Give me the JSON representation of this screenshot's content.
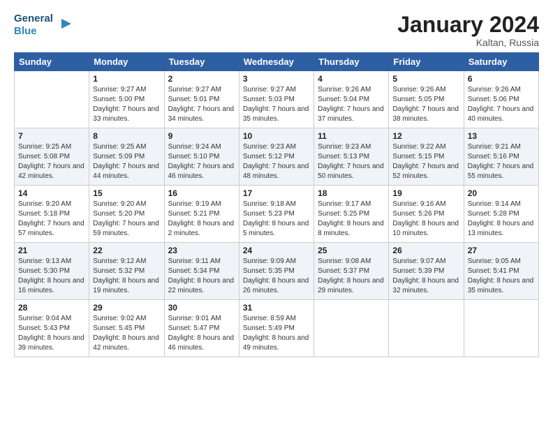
{
  "logo": {
    "line1": "General",
    "line2": "Blue"
  },
  "title": "January 2024",
  "location": "Kaltan, Russia",
  "days_header": [
    "Sunday",
    "Monday",
    "Tuesday",
    "Wednesday",
    "Thursday",
    "Friday",
    "Saturday"
  ],
  "weeks": [
    [
      {
        "num": "",
        "sunrise": "",
        "sunset": "",
        "daylight": ""
      },
      {
        "num": "1",
        "sunrise": "Sunrise: 9:27 AM",
        "sunset": "Sunset: 5:00 PM",
        "daylight": "Daylight: 7 hours and 33 minutes."
      },
      {
        "num": "2",
        "sunrise": "Sunrise: 9:27 AM",
        "sunset": "Sunset: 5:01 PM",
        "daylight": "Daylight: 7 hours and 34 minutes."
      },
      {
        "num": "3",
        "sunrise": "Sunrise: 9:27 AM",
        "sunset": "Sunset: 5:03 PM",
        "daylight": "Daylight: 7 hours and 35 minutes."
      },
      {
        "num": "4",
        "sunrise": "Sunrise: 9:26 AM",
        "sunset": "Sunset: 5:04 PM",
        "daylight": "Daylight: 7 hours and 37 minutes."
      },
      {
        "num": "5",
        "sunrise": "Sunrise: 9:26 AM",
        "sunset": "Sunset: 5:05 PM",
        "daylight": "Daylight: 7 hours and 38 minutes."
      },
      {
        "num": "6",
        "sunrise": "Sunrise: 9:26 AM",
        "sunset": "Sunset: 5:06 PM",
        "daylight": "Daylight: 7 hours and 40 minutes."
      }
    ],
    [
      {
        "num": "7",
        "sunrise": "Sunrise: 9:25 AM",
        "sunset": "Sunset: 5:08 PM",
        "daylight": "Daylight: 7 hours and 42 minutes."
      },
      {
        "num": "8",
        "sunrise": "Sunrise: 9:25 AM",
        "sunset": "Sunset: 5:09 PM",
        "daylight": "Daylight: 7 hours and 44 minutes."
      },
      {
        "num": "9",
        "sunrise": "Sunrise: 9:24 AM",
        "sunset": "Sunset: 5:10 PM",
        "daylight": "Daylight: 7 hours and 46 minutes."
      },
      {
        "num": "10",
        "sunrise": "Sunrise: 9:23 AM",
        "sunset": "Sunset: 5:12 PM",
        "daylight": "Daylight: 7 hours and 48 minutes."
      },
      {
        "num": "11",
        "sunrise": "Sunrise: 9:23 AM",
        "sunset": "Sunset: 5:13 PM",
        "daylight": "Daylight: 7 hours and 50 minutes."
      },
      {
        "num": "12",
        "sunrise": "Sunrise: 9:22 AM",
        "sunset": "Sunset: 5:15 PM",
        "daylight": "Daylight: 7 hours and 52 minutes."
      },
      {
        "num": "13",
        "sunrise": "Sunrise: 9:21 AM",
        "sunset": "Sunset: 5:16 PM",
        "daylight": "Daylight: 7 hours and 55 minutes."
      }
    ],
    [
      {
        "num": "14",
        "sunrise": "Sunrise: 9:20 AM",
        "sunset": "Sunset: 5:18 PM",
        "daylight": "Daylight: 7 hours and 57 minutes."
      },
      {
        "num": "15",
        "sunrise": "Sunrise: 9:20 AM",
        "sunset": "Sunset: 5:20 PM",
        "daylight": "Daylight: 7 hours and 59 minutes."
      },
      {
        "num": "16",
        "sunrise": "Sunrise: 9:19 AM",
        "sunset": "Sunset: 5:21 PM",
        "daylight": "Daylight: 8 hours and 2 minutes."
      },
      {
        "num": "17",
        "sunrise": "Sunrise: 9:18 AM",
        "sunset": "Sunset: 5:23 PM",
        "daylight": "Daylight: 8 hours and 5 minutes."
      },
      {
        "num": "18",
        "sunrise": "Sunrise: 9:17 AM",
        "sunset": "Sunset: 5:25 PM",
        "daylight": "Daylight: 8 hours and 8 minutes."
      },
      {
        "num": "19",
        "sunrise": "Sunrise: 9:16 AM",
        "sunset": "Sunset: 5:26 PM",
        "daylight": "Daylight: 8 hours and 10 minutes."
      },
      {
        "num": "20",
        "sunrise": "Sunrise: 9:14 AM",
        "sunset": "Sunset: 5:28 PM",
        "daylight": "Daylight: 8 hours and 13 minutes."
      }
    ],
    [
      {
        "num": "21",
        "sunrise": "Sunrise: 9:13 AM",
        "sunset": "Sunset: 5:30 PM",
        "daylight": "Daylight: 8 hours and 16 minutes."
      },
      {
        "num": "22",
        "sunrise": "Sunrise: 9:12 AM",
        "sunset": "Sunset: 5:32 PM",
        "daylight": "Daylight: 8 hours and 19 minutes."
      },
      {
        "num": "23",
        "sunrise": "Sunrise: 9:11 AM",
        "sunset": "Sunset: 5:34 PM",
        "daylight": "Daylight: 8 hours and 22 minutes."
      },
      {
        "num": "24",
        "sunrise": "Sunrise: 9:09 AM",
        "sunset": "Sunset: 5:35 PM",
        "daylight": "Daylight: 8 hours and 26 minutes."
      },
      {
        "num": "25",
        "sunrise": "Sunrise: 9:08 AM",
        "sunset": "Sunset: 5:37 PM",
        "daylight": "Daylight: 8 hours and 29 minutes."
      },
      {
        "num": "26",
        "sunrise": "Sunrise: 9:07 AM",
        "sunset": "Sunset: 5:39 PM",
        "daylight": "Daylight: 8 hours and 32 minutes."
      },
      {
        "num": "27",
        "sunrise": "Sunrise: 9:05 AM",
        "sunset": "Sunset: 5:41 PM",
        "daylight": "Daylight: 8 hours and 35 minutes."
      }
    ],
    [
      {
        "num": "28",
        "sunrise": "Sunrise: 9:04 AM",
        "sunset": "Sunset: 5:43 PM",
        "daylight": "Daylight: 8 hours and 39 minutes."
      },
      {
        "num": "29",
        "sunrise": "Sunrise: 9:02 AM",
        "sunset": "Sunset: 5:45 PM",
        "daylight": "Daylight: 8 hours and 42 minutes."
      },
      {
        "num": "30",
        "sunrise": "Sunrise: 9:01 AM",
        "sunset": "Sunset: 5:47 PM",
        "daylight": "Daylight: 8 hours and 46 minutes."
      },
      {
        "num": "31",
        "sunrise": "Sunrise: 8:59 AM",
        "sunset": "Sunset: 5:49 PM",
        "daylight": "Daylight: 8 hours and 49 minutes."
      },
      {
        "num": "",
        "sunrise": "",
        "sunset": "",
        "daylight": ""
      },
      {
        "num": "",
        "sunrise": "",
        "sunset": "",
        "daylight": ""
      },
      {
        "num": "",
        "sunrise": "",
        "sunset": "",
        "daylight": ""
      }
    ]
  ]
}
